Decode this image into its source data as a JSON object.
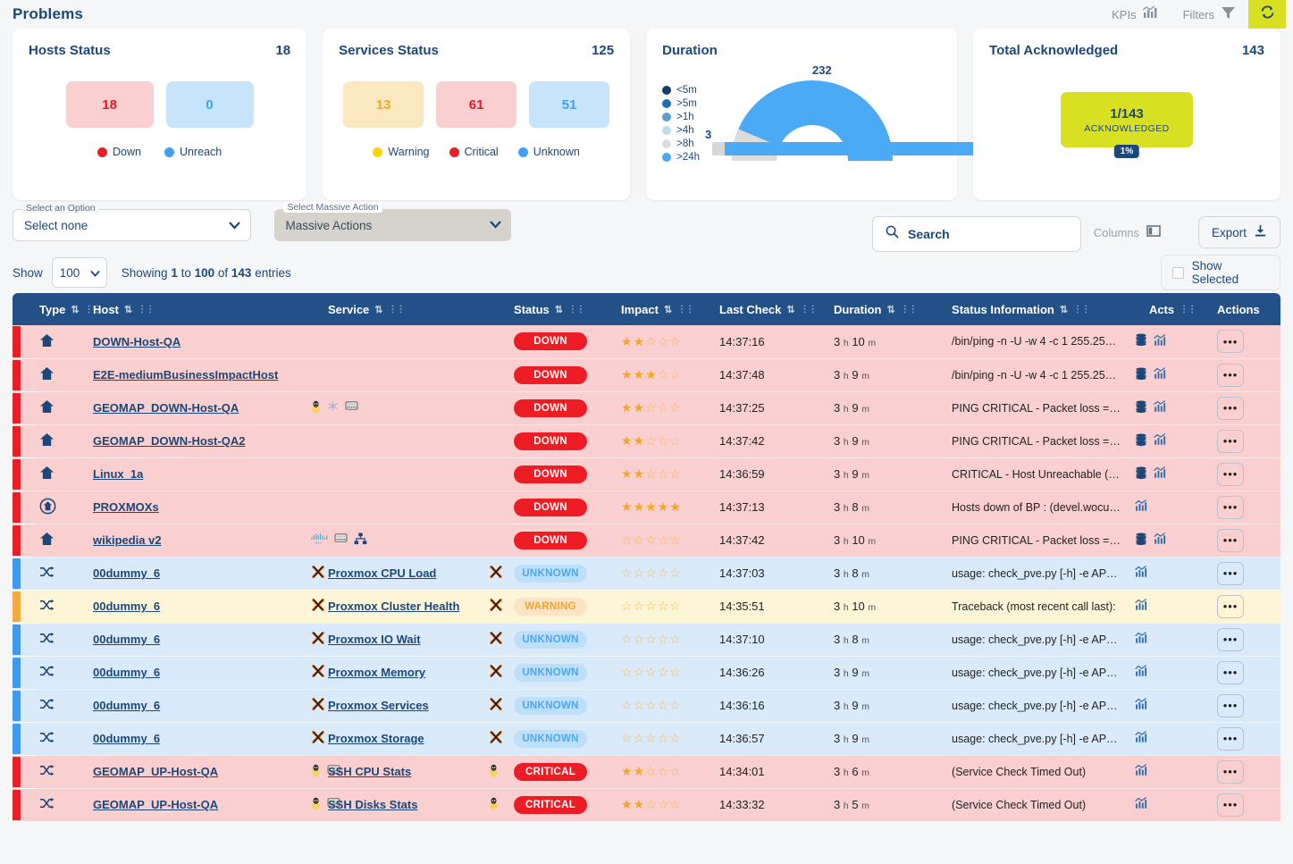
{
  "header": {
    "title": "Problems",
    "kpis_label": "KPIs",
    "filters_label": "Filters",
    "refresh_icon": "refresh-icon",
    "refresh_color": "#d9e021"
  },
  "cards": {
    "hosts": {
      "title": "Hosts Status",
      "count": "18",
      "tiles": [
        {
          "value": "18",
          "style": "red"
        },
        {
          "value": "0",
          "style": "blue"
        }
      ],
      "legend": [
        {
          "label": "Down",
          "color": "#ee1c25"
        },
        {
          "label": "Unreach",
          "color": "#3ea2f0"
        }
      ]
    },
    "services": {
      "title": "Services Status",
      "count": "125",
      "tiles": [
        {
          "value": "13",
          "style": "yellow"
        },
        {
          "value": "61",
          "style": "red"
        },
        {
          "value": "51",
          "style": "blue"
        }
      ],
      "legend": [
        {
          "label": "Warning",
          "color": "#ffd400"
        },
        {
          "label": "Critical",
          "color": "#ee1c25"
        },
        {
          "label": "Unknown",
          "color": "#3ea2f0"
        }
      ]
    },
    "duration": {
      "title": "Duration",
      "legend": [
        {
          "label": "<5m",
          "color": "#123f67"
        },
        {
          "label": ">5m",
          "color": "#1f6fae"
        },
        {
          "label": ">1h",
          "color": "#5c9dc9"
        },
        {
          "label": ">4h",
          "color": "#bcdbeb"
        },
        {
          "label": ">8h",
          "color": "#dcdcdc"
        },
        {
          "label": ">24h",
          "color": "#4aaaf5"
        }
      ],
      "gauge_top_value": "232",
      "gauge_left_value": "3"
    },
    "acknowledged": {
      "title": "Total Acknowledged",
      "count": "143",
      "ratio": "1/143",
      "caption": "ACKNOWLEDGED",
      "percent": "1%",
      "box_color": "#d9e021"
    }
  },
  "toolbar": {
    "option_select": {
      "label": "Select an Option",
      "value": "Select none"
    },
    "massive_select": {
      "label": "Select Massive Action",
      "value": "Massive Actions"
    },
    "search_placeholder": "Search",
    "columns_label": "Columns",
    "export_label": "Export",
    "show_label": "Show",
    "show_value": "100",
    "showing_prefix": "Showing ",
    "showing_from": "1",
    "showing_mid1": " to ",
    "showing_to": "100",
    "showing_mid2": " of ",
    "showing_total": "143",
    "showing_suffix": " entries",
    "show_selected_label": "Show Selected"
  },
  "table": {
    "columns": [
      {
        "key": "type",
        "label": "Type",
        "sortable": true
      },
      {
        "key": "host",
        "label": "Host",
        "sortable": true
      },
      {
        "key": "service",
        "label": "Service",
        "sortable": true
      },
      {
        "key": "status",
        "label": "Status",
        "sortable": true
      },
      {
        "key": "impact",
        "label": "Impact",
        "sortable": true
      },
      {
        "key": "last_check",
        "label": "Last Check",
        "sortable": true
      },
      {
        "key": "duration",
        "label": "Duration",
        "sortable": true
      },
      {
        "key": "status_information",
        "label": "Status Information",
        "sortable": true
      },
      {
        "key": "acts",
        "label": "Acts",
        "sortable": false
      },
      {
        "key": "actions",
        "label": "Actions",
        "sortable": false
      }
    ],
    "rows": [
      {
        "rowstyle": "down",
        "bar": "red",
        "type_icon": "host-icon",
        "host": "DOWN-Host-QA",
        "host_icons": [],
        "service": "",
        "service_icons": [],
        "status": "DOWN",
        "status_style": "down",
        "impact_filled": 2,
        "impact_total": 5,
        "last_check": "14:37:16",
        "duration_h": "3",
        "duration_m": "10",
        "status_information": "/bin/ping -n -U -w 4 -c 1 255.25…",
        "acts": [
          "log-icon",
          "graph-icon"
        ]
      },
      {
        "rowstyle": "down",
        "bar": "red",
        "type_icon": "host-icon",
        "host": "E2E-mediumBusinessImpactHost",
        "host_icons": [],
        "service": "",
        "service_icons": [],
        "status": "DOWN",
        "status_style": "down",
        "impact_filled": 3,
        "impact_total": 5,
        "last_check": "14:37:48",
        "duration_h": "3",
        "duration_m": "9",
        "status_information": "/bin/ping -n -U -w 4 -c 1 255.25…",
        "acts": [
          "log-icon",
          "graph-icon"
        ]
      },
      {
        "rowstyle": "down",
        "bar": "red",
        "type_icon": "host-icon",
        "host": "GEOMAP_DOWN-Host-QA",
        "host_icons": [
          "linux-icon",
          "snow-icon",
          "server-icon"
        ],
        "service": "",
        "service_icons": [],
        "status": "DOWN",
        "status_style": "down",
        "impact_filled": 2,
        "impact_total": 5,
        "last_check": "14:37:25",
        "duration_h": "3",
        "duration_m": "9",
        "status_information": "PING CRITICAL - Packet loss =…",
        "acts": [
          "log-icon",
          "graph-icon"
        ]
      },
      {
        "rowstyle": "down",
        "bar": "red",
        "type_icon": "host-icon",
        "host": "GEOMAP_DOWN-Host-QA2",
        "host_icons": [],
        "service": "",
        "service_icons": [],
        "status": "DOWN",
        "status_style": "down",
        "impact_filled": 2,
        "impact_total": 5,
        "last_check": "14:37:42",
        "duration_h": "3",
        "duration_m": "9",
        "status_information": "PING CRITICAL - Packet loss =…",
        "acts": [
          "log-icon",
          "graph-icon"
        ]
      },
      {
        "rowstyle": "down",
        "bar": "red",
        "type_icon": "host-icon",
        "host": "Linux_1a",
        "host_icons": [],
        "service": "",
        "service_icons": [],
        "status": "DOWN",
        "status_style": "down",
        "impact_filled": 2,
        "impact_total": 5,
        "last_check": "14:36:59",
        "duration_h": "3",
        "duration_m": "9",
        "status_information": "CRITICAL - Host Unreachable (…",
        "acts": [
          "log-icon",
          "graph-icon"
        ]
      },
      {
        "rowstyle": "down",
        "bar": "red",
        "type_icon": "business-process-icon",
        "host": "PROXMOXs",
        "host_icons": [],
        "service": "",
        "service_icons": [],
        "status": "DOWN",
        "status_style": "down",
        "impact_filled": 5,
        "impact_total": 5,
        "last_check": "14:37:13",
        "duration_h": "3",
        "duration_m": "8",
        "status_information": "Hosts down of BP : (devel.wocu…",
        "acts": [
          "graph-icon"
        ]
      },
      {
        "rowstyle": "down",
        "bar": "red",
        "type_icon": "host-icon",
        "host": "wikipedia v2",
        "host_icons": [
          "cisco-icon",
          "server-icon",
          "network-icon"
        ],
        "service": "",
        "service_icons": [],
        "status": "DOWN",
        "status_style": "down",
        "impact_filled": 0,
        "impact_total": 5,
        "last_check": "14:37:42",
        "duration_h": "3",
        "duration_m": "10",
        "status_information": "PING CRITICAL - Packet loss =…",
        "acts": [
          "log-icon",
          "graph-icon"
        ]
      },
      {
        "rowstyle": "unknown",
        "bar": "blue",
        "type_icon": "service-icon",
        "host": "00dummy_6",
        "host_icons": [
          "proxmox-icon"
        ],
        "service": "Proxmox CPU Load",
        "service_icons": [
          "proxmox-icon"
        ],
        "status": "UNKNOWN",
        "status_style": "unknown",
        "impact_filled": 0,
        "impact_total": 5,
        "last_check": "14:37:03",
        "duration_h": "3",
        "duration_m": "8",
        "status_information": "usage: check_pve.py [-h] -e AP…",
        "acts": [
          "graph-icon"
        ]
      },
      {
        "rowstyle": "warning",
        "bar": "orange",
        "type_icon": "service-icon",
        "host": "00dummy_6",
        "host_icons": [
          "proxmox-icon"
        ],
        "service": "Proxmox Cluster Health",
        "service_icons": [
          "proxmox-icon"
        ],
        "status": "WARNING",
        "status_style": "warning",
        "impact_filled": 0,
        "impact_total": 5,
        "last_check": "14:35:51",
        "duration_h": "3",
        "duration_m": "10",
        "status_information": "Traceback (most recent call last):",
        "acts": [
          "graph-icon"
        ]
      },
      {
        "rowstyle": "unknown",
        "bar": "blue",
        "type_icon": "service-icon",
        "host": "00dummy_6",
        "host_icons": [
          "proxmox-icon"
        ],
        "service": "Proxmox IO Wait",
        "service_icons": [
          "proxmox-icon"
        ],
        "status": "UNKNOWN",
        "status_style": "unknown",
        "impact_filled": 0,
        "impact_total": 5,
        "last_check": "14:37:10",
        "duration_h": "3",
        "duration_m": "8",
        "status_information": "usage: check_pve.py [-h] -e AP…",
        "acts": [
          "graph-icon"
        ]
      },
      {
        "rowstyle": "unknown",
        "bar": "blue",
        "type_icon": "service-icon",
        "host": "00dummy_6",
        "host_icons": [
          "proxmox-icon"
        ],
        "service": "Proxmox Memory",
        "service_icons": [
          "proxmox-icon"
        ],
        "status": "UNKNOWN",
        "status_style": "unknown",
        "impact_filled": 0,
        "impact_total": 5,
        "last_check": "14:36:26",
        "duration_h": "3",
        "duration_m": "9",
        "status_information": "usage: check_pve.py [-h] -e AP…",
        "acts": [
          "graph-icon"
        ]
      },
      {
        "rowstyle": "unknown",
        "bar": "blue",
        "type_icon": "service-icon",
        "host": "00dummy_6",
        "host_icons": [
          "proxmox-icon"
        ],
        "service": "Proxmox Services",
        "service_icons": [
          "proxmox-icon"
        ],
        "status": "UNKNOWN",
        "status_style": "unknown",
        "impact_filled": 0,
        "impact_total": 5,
        "last_check": "14:36:16",
        "duration_h": "3",
        "duration_m": "9",
        "status_information": "usage: check_pve.py [-h] -e AP…",
        "acts": [
          "graph-icon"
        ]
      },
      {
        "rowstyle": "unknown",
        "bar": "blue",
        "type_icon": "service-icon",
        "host": "00dummy_6",
        "host_icons": [
          "proxmox-icon"
        ],
        "service": "Proxmox Storage",
        "service_icons": [
          "proxmox-icon"
        ],
        "status": "UNKNOWN",
        "status_style": "unknown",
        "impact_filled": 0,
        "impact_total": 5,
        "last_check": "14:36:57",
        "duration_h": "3",
        "duration_m": "9",
        "status_information": "usage: check_pve.py [-h] -e AP…",
        "acts": [
          "graph-icon"
        ]
      },
      {
        "rowstyle": "critical",
        "bar": "red",
        "type_icon": "service-icon",
        "host": "GEOMAP_UP-Host-QA",
        "host_icons": [
          "linux-icon",
          "server-icon"
        ],
        "service": "SSH CPU Stats",
        "service_icons": [
          "linux-icon"
        ],
        "status": "CRITICAL",
        "status_style": "critical",
        "impact_filled": 2,
        "impact_total": 5,
        "last_check": "14:34:01",
        "duration_h": "3",
        "duration_m": "6",
        "status_information": "(Service Check Timed Out)",
        "acts": [
          "graph-icon"
        ]
      },
      {
        "rowstyle": "critical",
        "bar": "red",
        "type_icon": "service-icon",
        "host": "GEOMAP_UP-Host-QA",
        "host_icons": [
          "linux-icon",
          "server-icon"
        ],
        "service": "SSH Disks Stats",
        "service_icons": [
          "linux-icon"
        ],
        "status": "CRITICAL",
        "status_style": "critical",
        "impact_filled": 2,
        "impact_total": 5,
        "last_check": "14:33:32",
        "duration_h": "3",
        "duration_m": "5",
        "status_information": "(Service Check Timed Out)",
        "acts": [
          "graph-icon"
        ]
      }
    ]
  }
}
